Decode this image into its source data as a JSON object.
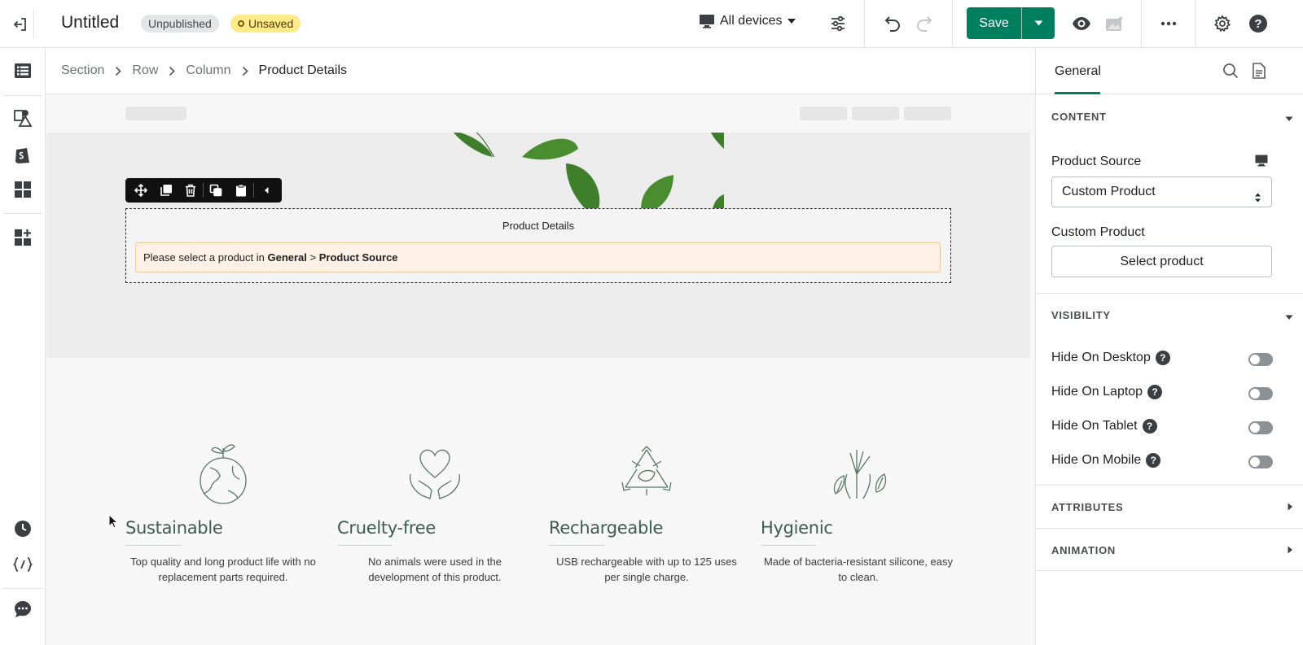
{
  "header": {
    "title": "Untitled",
    "badge_unpublished": "Unpublished",
    "badge_unsaved": "Unsaved",
    "devices_label": "All devices",
    "save_label": "Save"
  },
  "breadcrumb": [
    "Section",
    "Row",
    "Column",
    "Product Details"
  ],
  "canvas": {
    "element_heading": "Product Details",
    "alert_prefix": "Please select a product in ",
    "alert_general": "General",
    "alert_sep": " > ",
    "alert_source": "Product Source",
    "features": [
      {
        "title": "Sustainable",
        "desc": "Top quality and long product life with no replacement parts required.",
        "icon": "globe-leaf-icon"
      },
      {
        "title": "Cruelty-free",
        "desc": "No animals were used in the development of this product.",
        "icon": "heart-hands-icon"
      },
      {
        "title": "Rechargeable",
        "desc": "USB rechargeable with up to 125 uses per single charge.",
        "icon": "recycle-icon"
      },
      {
        "title": "Hygienic",
        "desc": "Made of bacteria-resistant silicone, easy to clean.",
        "icon": "hand-leaf-icon"
      }
    ]
  },
  "panel": {
    "tab_general": "General",
    "content_heading": "CONTENT",
    "product_source_label": "Product Source",
    "product_source_value": "Custom Product",
    "custom_product_label": "Custom Product",
    "select_product_button": "Select product",
    "visibility_heading": "VISIBILITY",
    "toggles": [
      "Hide On Desktop",
      "Hide On Laptop",
      "Hide On Tablet",
      "Hide On Mobile"
    ],
    "attributes_heading": "ATTRIBUTES",
    "animation_heading": "ANIMATION"
  },
  "colors": {
    "accent": "#007f5f",
    "feature_text": "#3e5b4f",
    "alert_bg": "#fdf1e6",
    "unsaved_badge": "#ffea8a"
  }
}
